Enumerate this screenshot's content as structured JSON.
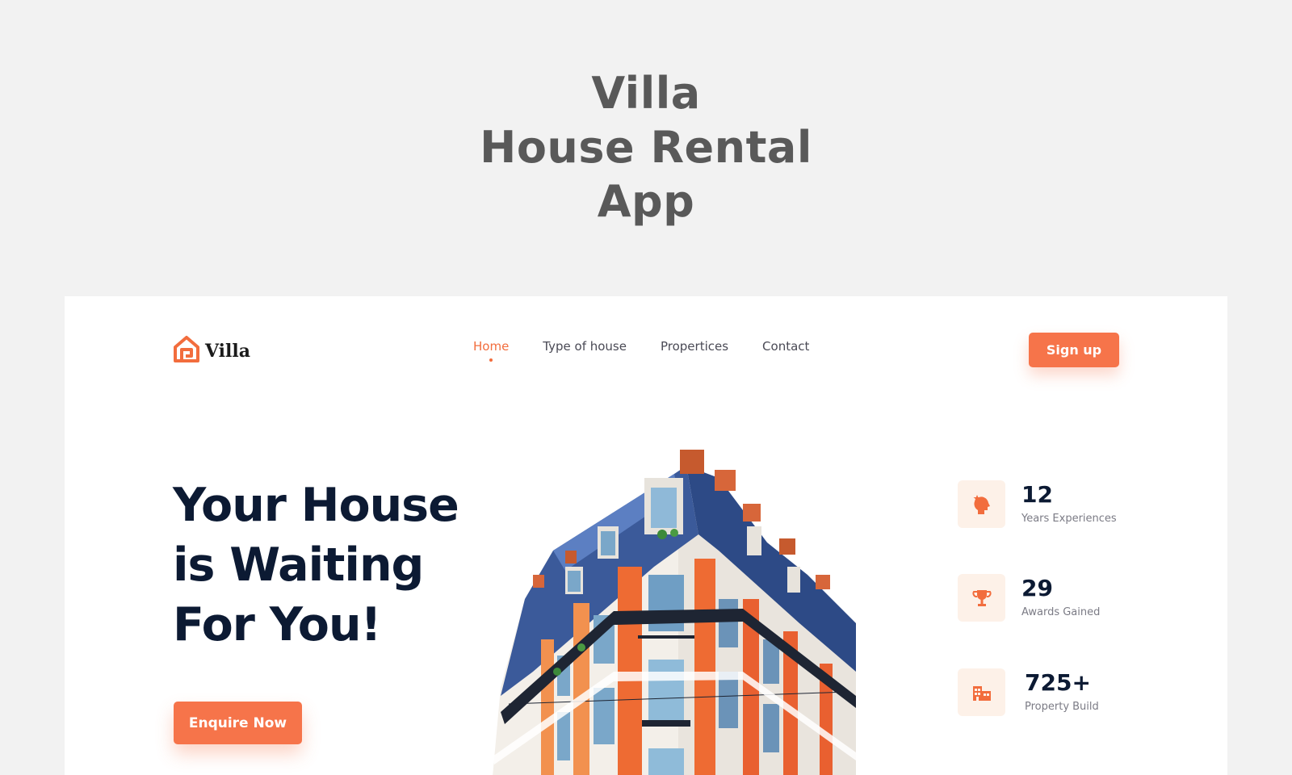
{
  "showcase": {
    "title_line1": "Villa",
    "title_line2": "House Rental",
    "title_line3": "App"
  },
  "header": {
    "logo_text": "Villa",
    "nav": [
      {
        "label": "Home",
        "active": true
      },
      {
        "label": "Type of house",
        "active": false
      },
      {
        "label": "Propertices",
        "active": false
      },
      {
        "label": "Contact",
        "active": false
      }
    ],
    "signup_label": "Sign up"
  },
  "hero": {
    "title_line1": "Your House",
    "title_line2": "is Waiting",
    "title_line3": "For You!",
    "cta_label": "Enquire Now"
  },
  "stats": [
    {
      "value": "12",
      "label": "Years Experiences",
      "icon": "head-star-icon"
    },
    {
      "value": "29",
      "label": "Awards Gained",
      "icon": "trophy-icon"
    },
    {
      "value": "725+",
      "label": "Property Build",
      "icon": "buildings-icon"
    }
  ],
  "colors": {
    "accent": "#f6744a",
    "heading": "#0c1a33",
    "background": "#f2f2f2",
    "icon_box": "#fdf1e8"
  }
}
